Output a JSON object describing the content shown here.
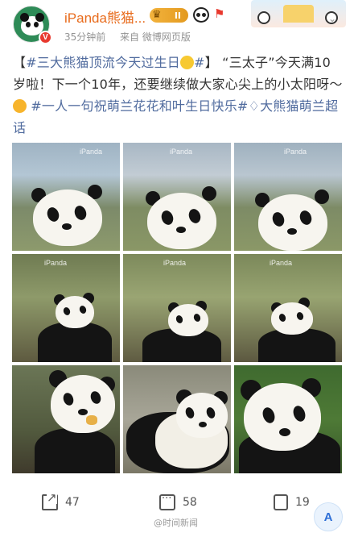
{
  "header": {
    "username": "iPanda熊猫...",
    "level": "II",
    "timestamp": "35分钟前",
    "source": "来自 微博网页版"
  },
  "post": {
    "tag1": "#三大熊猫顶流今天过生日",
    "tag1_end": "#",
    "bracket_open": "【",
    "bracket_close": "】",
    "text1": "“三太子”今天满10岁啦！下一个10年，还要继续做大家心尖上的小太阳呀～",
    "tag2": "#一人一句祝萌兰花花和叶生日快乐#",
    "tag3": "大熊猫萌兰超话"
  },
  "photos": {
    "watermark": "iPanda"
  },
  "actions": {
    "share_count": "47",
    "comment_count": "58",
    "like_count": "19"
  },
  "footer": {
    "watermark": "@时间新闻"
  },
  "float_button": {
    "label": "A"
  },
  "colors": {
    "username": "#e86b1c",
    "hashtag": "#506b9e",
    "vbadge": "#e8392e"
  }
}
